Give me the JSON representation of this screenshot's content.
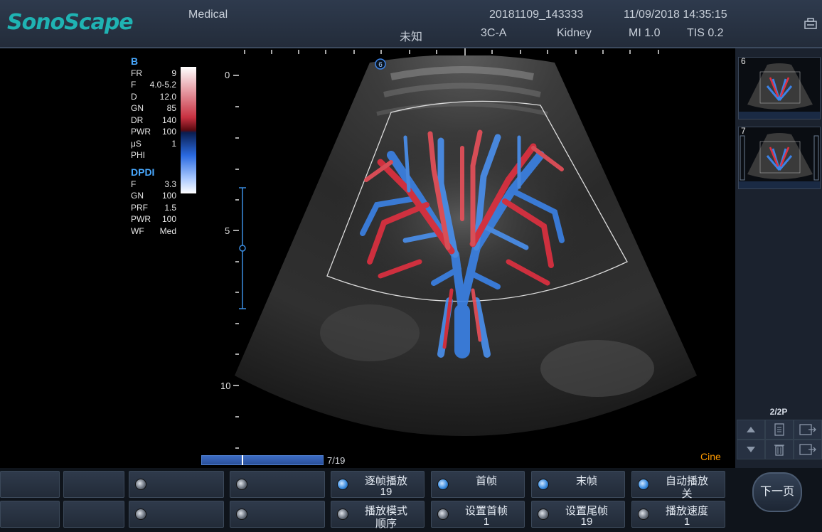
{
  "header": {
    "brand": "SonoScape",
    "hospital": "Medical",
    "exam_id": "20181109_143333",
    "datetime": "11/09/2018 14:35:15",
    "patient": "未知",
    "probe": "3C-A",
    "preset": "Kidney",
    "mi": "MI 1.0",
    "tis": "TIS 0.2",
    "settings_icon": "config-icon"
  },
  "b_mode": {
    "title": "B",
    "params": [
      {
        "k": "FR",
        "v": "9"
      },
      {
        "k": "F",
        "v": "4.0-5.2"
      },
      {
        "k": "D",
        "v": "12.0"
      },
      {
        "k": "GN",
        "v": "85"
      },
      {
        "k": "DR",
        "v": "140"
      },
      {
        "k": "PWR",
        "v": "100"
      },
      {
        "k": "μS",
        "v": "1"
      },
      {
        "k": "PHI",
        "v": ""
      }
    ]
  },
  "dpdi": {
    "title": "DPDI",
    "params": [
      {
        "k": "F",
        "v": "3.3"
      },
      {
        "k": "GN",
        "v": "100"
      },
      {
        "k": "PRF",
        "v": "1.5"
      },
      {
        "k": "PWR",
        "v": "100"
      },
      {
        "k": "WF",
        "v": "Med"
      }
    ]
  },
  "depth_scale": {
    "labels": [
      "0",
      "5",
      "10"
    ]
  },
  "cine": {
    "label": "Cine",
    "frame_counter": "7/19",
    "position": 0.33
  },
  "focus_marker": "6",
  "thumbnails": [
    {
      "num": "6"
    },
    {
      "num": "7"
    }
  ],
  "pager": {
    "text": "2/2P"
  },
  "colors": {
    "accent": "#1fb3b3",
    "param_header": "#49a9ff",
    "cine": "#ff9a00",
    "doppler_red": "#e03040",
    "doppler_blue": "#3b82e6"
  },
  "softkeys": {
    "frame_by_frame": {
      "label": "逐帧播放",
      "value": "19"
    },
    "first_frame": {
      "label": "首帧"
    },
    "last_frame": {
      "label": "末帧"
    },
    "auto_play": {
      "label": "自动播放",
      "value": "关"
    },
    "play_mode": {
      "label": "播放模式",
      "value": "顺序"
    },
    "set_first": {
      "label": "设置首帧",
      "value": "1"
    },
    "set_last": {
      "label": "设置尾帧",
      "value": "19"
    },
    "play_speed": {
      "label": "播放速度",
      "value": "1"
    },
    "next_page": "下一页"
  }
}
